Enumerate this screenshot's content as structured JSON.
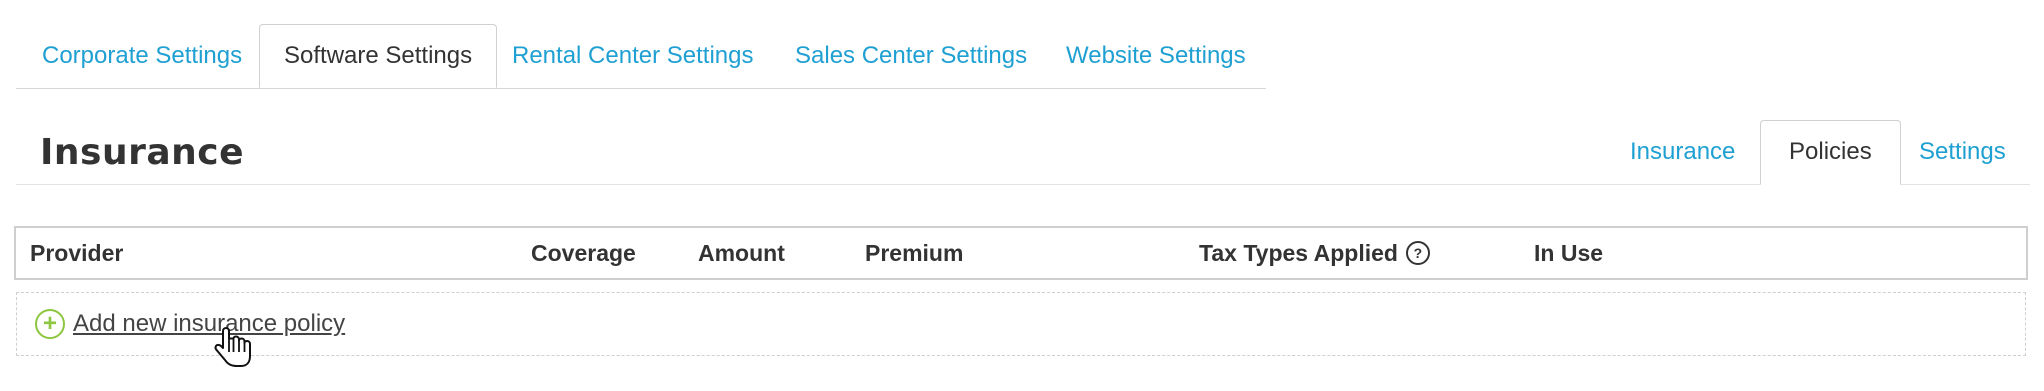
{
  "top_tabs": [
    {
      "label": "Corporate Settings"
    },
    {
      "label": "Software Settings"
    },
    {
      "label": "Rental Center Settings"
    },
    {
      "label": "Sales Center Settings"
    },
    {
      "label": "Website Settings"
    }
  ],
  "active_top_tab": "Software Settings",
  "section": {
    "title": "Insurance",
    "sub_tabs": [
      {
        "label": "Insurance"
      },
      {
        "label": "Policies"
      },
      {
        "label": "Settings"
      }
    ],
    "active_sub_tab": "Policies"
  },
  "table": {
    "columns": [
      {
        "label": "Provider"
      },
      {
        "label": "Coverage"
      },
      {
        "label": "Amount"
      },
      {
        "label": "Premium"
      },
      {
        "label": "Tax Types Applied"
      },
      {
        "label": "In Use"
      }
    ],
    "help_icon_glyph": "?",
    "add_row": {
      "plus_glyph": "+",
      "label": "Add new insurance policy"
    }
  },
  "colors": {
    "link": "#1fa0d2",
    "text": "#333333",
    "add_icon": "#8dc63f",
    "border": "#cfcfcf"
  },
  "icons": {
    "help": "question-circle-icon",
    "add": "plus-circle-icon",
    "pointer": "hand-pointer-cursor-icon"
  }
}
